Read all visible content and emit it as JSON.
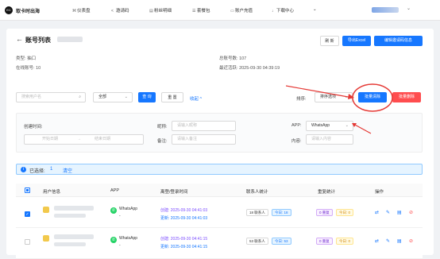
{
  "topbar": {
    "logo": "EC",
    "brand": "取卡时出海",
    "nav": [
      {
        "icon": "⌘",
        "label": "仪表盘"
      },
      {
        "icon": "<",
        "label": "邀请码"
      },
      {
        "icon": "▤",
        "label": "粉丝明细"
      },
      {
        "icon": "☰",
        "label": "套餐包"
      },
      {
        "icon": "▭",
        "label": "账户充值"
      },
      {
        "icon": "↓",
        "label": "下载中心"
      }
    ],
    "more": "⌄",
    "user_caret": "⌄"
  },
  "header": {
    "back_icon": "←",
    "title": "账号列表",
    "buttons": {
      "refresh": "刷 新",
      "export": "导出Excel",
      "edit_device": "编辑邀请码信息"
    }
  },
  "info": {
    "type_label": "类型:",
    "type_value": "抽口",
    "online_label": "在线账号:",
    "online_value": "10",
    "total_label": "总账号数:",
    "total_value": "107",
    "last_label": "最近活跃:",
    "last_value": "2025-09-30 04:39:19"
  },
  "search": {
    "input_placeholder": "搜索用户名",
    "search_icon": "⌕",
    "all_select": "全部",
    "search_btn": "查 询",
    "reset_btn": "重 置",
    "collapse": "收起 ^",
    "sort_label": "排序:",
    "sort_select": "排序选项",
    "batch_clear": "批量清除",
    "batch_delete": "批量删除"
  },
  "filters": {
    "created_label": "创建时间:",
    "start_placeholder": "开始日期",
    "arrow": "→",
    "end_placeholder": "结束日期",
    "nickname_label": "昵称:",
    "nickname_placeholder": "请输入昵称",
    "remark_label": "备注:",
    "remark_placeholder": "请输入备注",
    "app_label": "APP:",
    "app_value": "WhatsApp",
    "content_label": "内容:",
    "content_placeholder": "请输入内容"
  },
  "selection": {
    "icon": "i",
    "text": "已选择: ",
    "count": "1",
    "clear": "清空"
  },
  "table": {
    "headers": [
      "用户信息",
      "APP",
      "离登/登录时间",
      "联系人统计",
      "重复统计",
      "操作"
    ],
    "rows": [
      {
        "checked": true,
        "app": "WhatsApp",
        "app_sub": "-",
        "created": "创建: 2025-09-30 04:41:03",
        "updated": "更新: 2025-09-30 04:41:03",
        "contacts_total": "18 联系人",
        "contacts_today": "今日: 18",
        "dup_total": "0 重复",
        "dup_today": "今日: 0"
      },
      {
        "checked": false,
        "app": "WhatsApp",
        "app_sub": "-",
        "created": "创建: 2025-09-30 04:41:15",
        "updated": "更新: 2025-09-30 04:41:15",
        "contacts_total": "53 联系人",
        "contacts_today": "今日: 53",
        "dup_total": "0 重复",
        "dup_today": "今日: 0"
      }
    ],
    "op_icons": [
      "⇄",
      "✎",
      "▤",
      "⊘"
    ]
  },
  "colors": {
    "primary": "#1677ff",
    "danger": "#ff4d4f",
    "whatsapp": "#25d366",
    "annotation": "#e53935"
  }
}
